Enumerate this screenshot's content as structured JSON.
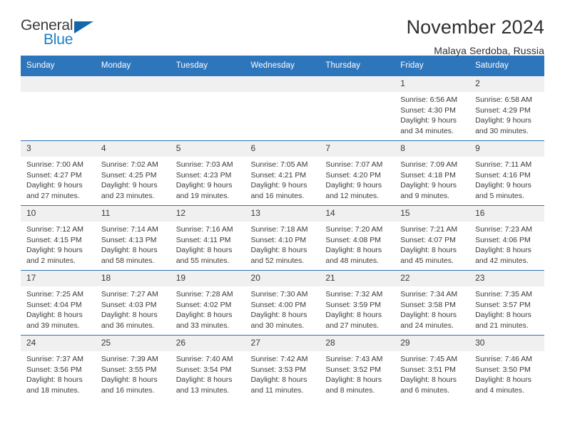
{
  "brand": {
    "name_part1": "General",
    "name_part2": "Blue",
    "triangle_color": "#1565ad",
    "blue_color": "#1c7ec4"
  },
  "header": {
    "title": "November 2024",
    "subtitle": "Malaya Serdoba, Russia"
  },
  "theme": {
    "header_row_bg": "#2e76bc",
    "daynum_bg": "#f0f0f0",
    "text_color": "#3a3a3a"
  },
  "weekdays": [
    "Sunday",
    "Monday",
    "Tuesday",
    "Wednesday",
    "Thursday",
    "Friday",
    "Saturday"
  ],
  "labels": {
    "sunrise": "Sunrise:",
    "sunset": "Sunset:",
    "daylight": "Daylight:"
  },
  "weeks": [
    [
      {
        "day": "",
        "empty": true
      },
      {
        "day": "",
        "empty": true
      },
      {
        "day": "",
        "empty": true
      },
      {
        "day": "",
        "empty": true
      },
      {
        "day": "",
        "empty": true
      },
      {
        "day": "1",
        "sunrise": "Sunrise: 6:56 AM",
        "sunset": "Sunset: 4:30 PM",
        "daylight": "Daylight: 9 hours and 34 minutes."
      },
      {
        "day": "2",
        "sunrise": "Sunrise: 6:58 AM",
        "sunset": "Sunset: 4:29 PM",
        "daylight": "Daylight: 9 hours and 30 minutes."
      }
    ],
    [
      {
        "day": "3",
        "sunrise": "Sunrise: 7:00 AM",
        "sunset": "Sunset: 4:27 PM",
        "daylight": "Daylight: 9 hours and 27 minutes."
      },
      {
        "day": "4",
        "sunrise": "Sunrise: 7:02 AM",
        "sunset": "Sunset: 4:25 PM",
        "daylight": "Daylight: 9 hours and 23 minutes."
      },
      {
        "day": "5",
        "sunrise": "Sunrise: 7:03 AM",
        "sunset": "Sunset: 4:23 PM",
        "daylight": "Daylight: 9 hours and 19 minutes."
      },
      {
        "day": "6",
        "sunrise": "Sunrise: 7:05 AM",
        "sunset": "Sunset: 4:21 PM",
        "daylight": "Daylight: 9 hours and 16 minutes."
      },
      {
        "day": "7",
        "sunrise": "Sunrise: 7:07 AM",
        "sunset": "Sunset: 4:20 PM",
        "daylight": "Daylight: 9 hours and 12 minutes."
      },
      {
        "day": "8",
        "sunrise": "Sunrise: 7:09 AM",
        "sunset": "Sunset: 4:18 PM",
        "daylight": "Daylight: 9 hours and 9 minutes."
      },
      {
        "day": "9",
        "sunrise": "Sunrise: 7:11 AM",
        "sunset": "Sunset: 4:16 PM",
        "daylight": "Daylight: 9 hours and 5 minutes."
      }
    ],
    [
      {
        "day": "10",
        "sunrise": "Sunrise: 7:12 AM",
        "sunset": "Sunset: 4:15 PM",
        "daylight": "Daylight: 9 hours and 2 minutes."
      },
      {
        "day": "11",
        "sunrise": "Sunrise: 7:14 AM",
        "sunset": "Sunset: 4:13 PM",
        "daylight": "Daylight: 8 hours and 58 minutes."
      },
      {
        "day": "12",
        "sunrise": "Sunrise: 7:16 AM",
        "sunset": "Sunset: 4:11 PM",
        "daylight": "Daylight: 8 hours and 55 minutes."
      },
      {
        "day": "13",
        "sunrise": "Sunrise: 7:18 AM",
        "sunset": "Sunset: 4:10 PM",
        "daylight": "Daylight: 8 hours and 52 minutes."
      },
      {
        "day": "14",
        "sunrise": "Sunrise: 7:20 AM",
        "sunset": "Sunset: 4:08 PM",
        "daylight": "Daylight: 8 hours and 48 minutes."
      },
      {
        "day": "15",
        "sunrise": "Sunrise: 7:21 AM",
        "sunset": "Sunset: 4:07 PM",
        "daylight": "Daylight: 8 hours and 45 minutes."
      },
      {
        "day": "16",
        "sunrise": "Sunrise: 7:23 AM",
        "sunset": "Sunset: 4:06 PM",
        "daylight": "Daylight: 8 hours and 42 minutes."
      }
    ],
    [
      {
        "day": "17",
        "sunrise": "Sunrise: 7:25 AM",
        "sunset": "Sunset: 4:04 PM",
        "daylight": "Daylight: 8 hours and 39 minutes."
      },
      {
        "day": "18",
        "sunrise": "Sunrise: 7:27 AM",
        "sunset": "Sunset: 4:03 PM",
        "daylight": "Daylight: 8 hours and 36 minutes."
      },
      {
        "day": "19",
        "sunrise": "Sunrise: 7:28 AM",
        "sunset": "Sunset: 4:02 PM",
        "daylight": "Daylight: 8 hours and 33 minutes."
      },
      {
        "day": "20",
        "sunrise": "Sunrise: 7:30 AM",
        "sunset": "Sunset: 4:00 PM",
        "daylight": "Daylight: 8 hours and 30 minutes."
      },
      {
        "day": "21",
        "sunrise": "Sunrise: 7:32 AM",
        "sunset": "Sunset: 3:59 PM",
        "daylight": "Daylight: 8 hours and 27 minutes."
      },
      {
        "day": "22",
        "sunrise": "Sunrise: 7:34 AM",
        "sunset": "Sunset: 3:58 PM",
        "daylight": "Daylight: 8 hours and 24 minutes."
      },
      {
        "day": "23",
        "sunrise": "Sunrise: 7:35 AM",
        "sunset": "Sunset: 3:57 PM",
        "daylight": "Daylight: 8 hours and 21 minutes."
      }
    ],
    [
      {
        "day": "24",
        "sunrise": "Sunrise: 7:37 AM",
        "sunset": "Sunset: 3:56 PM",
        "daylight": "Daylight: 8 hours and 18 minutes."
      },
      {
        "day": "25",
        "sunrise": "Sunrise: 7:39 AM",
        "sunset": "Sunset: 3:55 PM",
        "daylight": "Daylight: 8 hours and 16 minutes."
      },
      {
        "day": "26",
        "sunrise": "Sunrise: 7:40 AM",
        "sunset": "Sunset: 3:54 PM",
        "daylight": "Daylight: 8 hours and 13 minutes."
      },
      {
        "day": "27",
        "sunrise": "Sunrise: 7:42 AM",
        "sunset": "Sunset: 3:53 PM",
        "daylight": "Daylight: 8 hours and 11 minutes."
      },
      {
        "day": "28",
        "sunrise": "Sunrise: 7:43 AM",
        "sunset": "Sunset: 3:52 PM",
        "daylight": "Daylight: 8 hours and 8 minutes."
      },
      {
        "day": "29",
        "sunrise": "Sunrise: 7:45 AM",
        "sunset": "Sunset: 3:51 PM",
        "daylight": "Daylight: 8 hours and 6 minutes."
      },
      {
        "day": "30",
        "sunrise": "Sunrise: 7:46 AM",
        "sunset": "Sunset: 3:50 PM",
        "daylight": "Daylight: 8 hours and 4 minutes."
      }
    ]
  ]
}
